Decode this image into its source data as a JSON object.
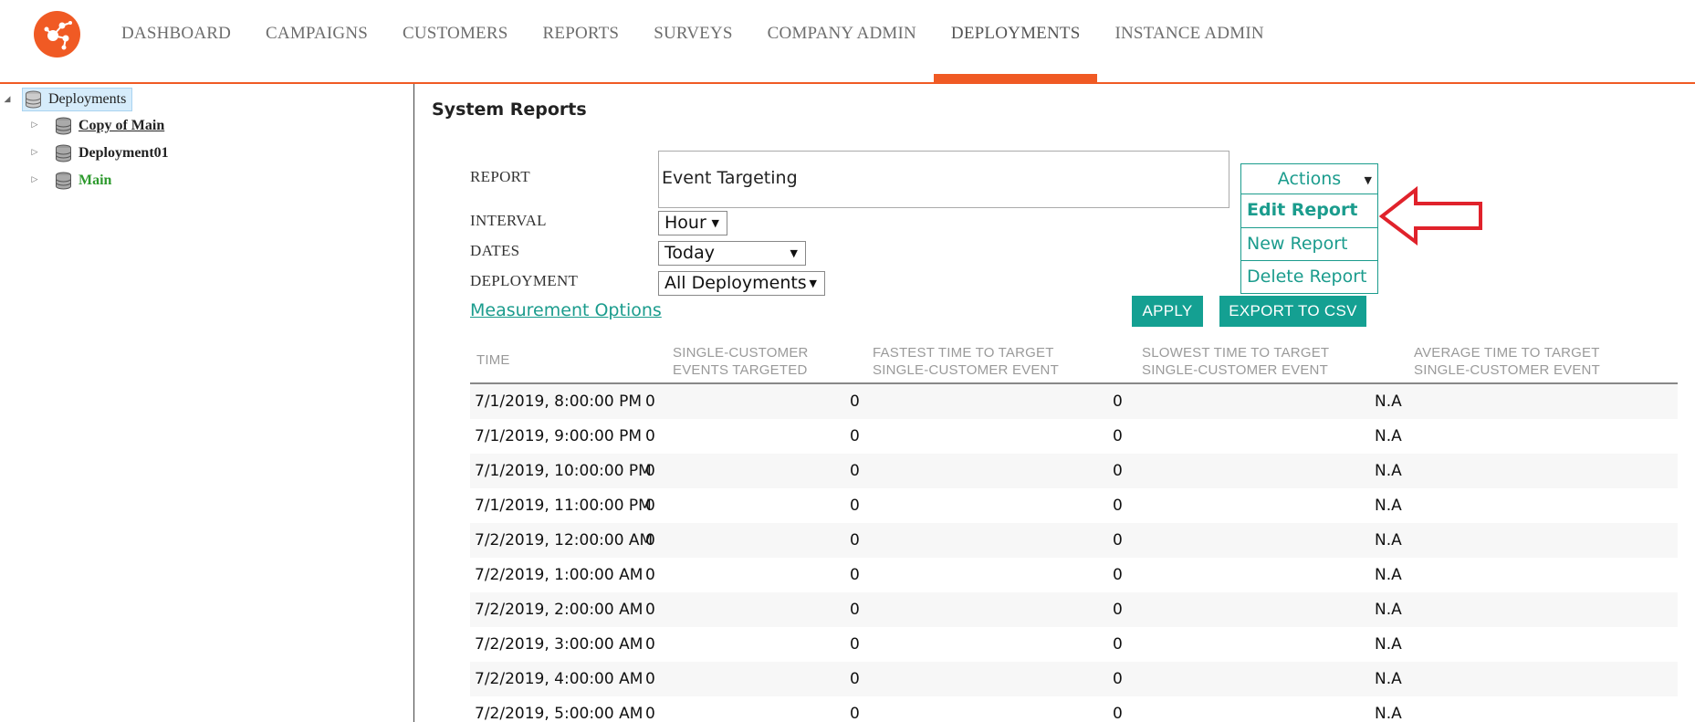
{
  "nav": {
    "items": [
      "DASHBOARD",
      "CAMPAIGNS",
      "CUSTOMERS",
      "REPORTS",
      "SURVEYS",
      "COMPANY ADMIN",
      "DEPLOYMENTS",
      "INSTANCE ADMIN"
    ],
    "active": "DEPLOYMENTS"
  },
  "tree": {
    "root": "Deployments",
    "children": [
      "Copy of Main",
      "Deployment01",
      "Main"
    ]
  },
  "page": {
    "title": "System Reports"
  },
  "form": {
    "report_label": "REPORT",
    "report_value": "Event Targeting",
    "interval_label": "INTERVAL",
    "interval_value": "Hour",
    "dates_label": "DATES",
    "dates_value": "Today",
    "deployment_label": "DEPLOYMENT",
    "deployment_value": "All Deployments",
    "measurement_link": "Measurement Options"
  },
  "buttons": {
    "apply": "APPLY",
    "export": "EXPORT TO CSV"
  },
  "actions": {
    "label": "Actions",
    "items": [
      "Edit Report",
      "New Report",
      "Delete Report"
    ]
  },
  "table": {
    "headers": [
      [
        "TIME",
        ""
      ],
      [
        "SINGLE-CUSTOMER",
        "EVENTS TARGETED"
      ],
      [
        "FASTEST TIME TO TARGET",
        "SINGLE-CUSTOMER EVENT"
      ],
      [
        "SLOWEST TIME TO TARGET",
        "SINGLE-CUSTOMER EVENT"
      ],
      [
        "AVERAGE TIME TO TARGET",
        "SINGLE-CUSTOMER EVENT"
      ]
    ],
    "rows": [
      [
        "7/1/2019, 8:00:00 PM",
        "0",
        "0",
        "0",
        "N.A"
      ],
      [
        "7/1/2019, 9:00:00 PM",
        "0",
        "0",
        "0",
        "N.A"
      ],
      [
        "7/1/2019, 10:00:00 PM",
        "0",
        "0",
        "0",
        "N.A"
      ],
      [
        "7/1/2019, 11:00:00 PM",
        "0",
        "0",
        "0",
        "N.A"
      ],
      [
        "7/2/2019, 12:00:00 AM",
        "0",
        "0",
        "0",
        "N.A"
      ],
      [
        "7/2/2019, 1:00:00 AM",
        "0",
        "0",
        "0",
        "N.A"
      ],
      [
        "7/2/2019, 2:00:00 AM",
        "0",
        "0",
        "0",
        "N.A"
      ],
      [
        "7/2/2019, 3:00:00 AM",
        "0",
        "0",
        "0",
        "N.A"
      ],
      [
        "7/2/2019, 4:00:00 AM",
        "0",
        "0",
        "0",
        "N.A"
      ],
      [
        "7/2/2019, 5:00:00 AM",
        "0",
        "0",
        "0",
        "N.A"
      ]
    ]
  },
  "colors": {
    "accent": "#f05a24",
    "teal": "#14a092",
    "arrow": "#e0222b"
  }
}
